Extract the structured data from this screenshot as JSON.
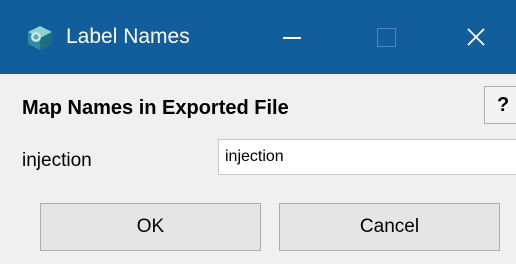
{
  "window": {
    "title": "Label Names",
    "icon": "app-icon"
  },
  "dialog": {
    "heading": "Map Names in Exported File",
    "help_label": "?",
    "fields": [
      {
        "label": "injection",
        "value": "injection"
      }
    ],
    "ok_label": "OK",
    "cancel_label": "Cancel"
  },
  "colors": {
    "titlebar": "#125e9c",
    "background": "#f0f0f0",
    "button": "#e5e5e5",
    "button_border": "#adadad"
  }
}
